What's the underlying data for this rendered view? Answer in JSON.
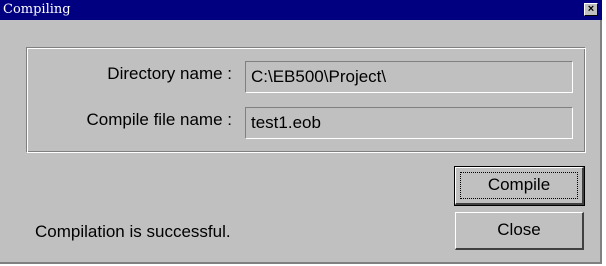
{
  "window": {
    "title": "Compiling",
    "close_symbol": "×"
  },
  "form": {
    "directory_label": "Directory name :",
    "directory_value": "C:\\EB500\\Project\\",
    "file_label": "Compile file name :",
    "file_value": "test1.eob"
  },
  "buttons": {
    "compile_label": "Compile",
    "close_label": "Close"
  },
  "status": {
    "message": "Compilation is successful."
  },
  "icons": {
    "close": "close-icon"
  },
  "colors": {
    "titlebar": "#000080",
    "face": "#c0c0c0"
  }
}
